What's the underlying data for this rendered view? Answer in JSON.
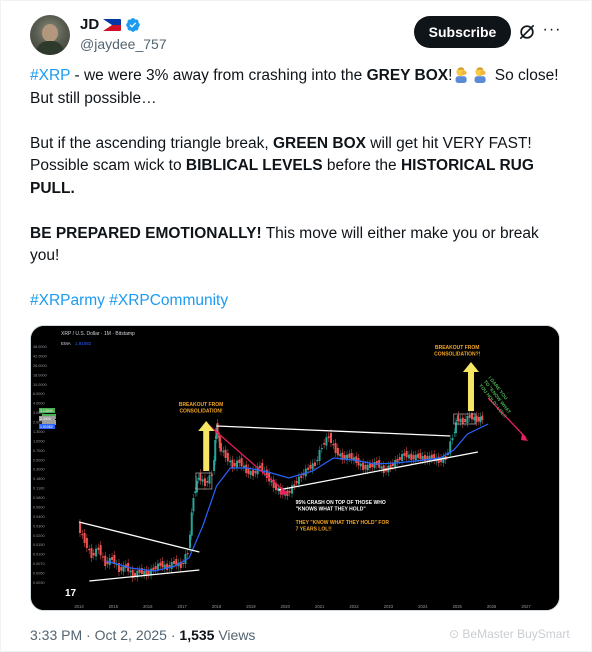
{
  "author": {
    "name": "JD",
    "handle": "@jaydee_757"
  },
  "actions": {
    "subscribe_label": "Subscribe"
  },
  "tweet": {
    "p1": {
      "hashtag": "#XRP",
      "t1": " - we were 3% away from crashing into the ",
      "b1": "GREY BOX",
      "t2": "!",
      "t3": " So close! But still possible…"
    },
    "p2": {
      "t1": "But if the ascending triangle break, ",
      "b1": "GREEN BOX",
      "t2": " will get hit VERY FAST! Possible scam wick to ",
      "b2": "BIBLICAL LEVELS",
      "t3": " before the ",
      "b3": "HISTORICAL RUG PULL."
    },
    "p3": {
      "b1": "BE PREPARED EMOTIONALLY!",
      "t1": " This move will either make you or break you!"
    },
    "p4": {
      "h1": "#XRParmy",
      "h2": "#XRPCommunity"
    }
  },
  "chart": {
    "header": "XRP / U.S. Dollar · 1M · Bitstamp",
    "ema_label": "EMA",
    "ema_value": "1.91082",
    "price_labels": [
      "48.0000",
      "42.0000",
      "26.0000",
      "18.0000",
      "10.0000",
      "6.0000",
      "4.0000",
      "3.0000",
      "2.0000",
      "1.3000",
      "1.0000",
      "0.7000",
      "0.5000",
      "0.3000",
      "0.1800",
      "0.1100",
      "0.0800",
      "0.0600",
      "0.0400",
      "0.0300",
      "0.0200",
      "0.0150",
      "0.0100",
      "0.0070",
      "0.0050",
      "0.0030"
    ],
    "tags": [
      "3.13000",
      "2.3000",
      "1.91082"
    ],
    "years": [
      "2014",
      "2015",
      "2016",
      "2017",
      "2018",
      "2019",
      "2020",
      "2021",
      "2022",
      "2023",
      "2024",
      "2025",
      "2026",
      "2027"
    ],
    "ann_breakout_left": [
      "BREAKOUT FROM",
      "CONSOLIDATION!"
    ],
    "ann_breakout_right": [
      "BREAKOUT FROM",
      "CONSOLIDATION?!"
    ],
    "ann_crash": [
      "95% CRASH ON TOP OF THOSE WHO",
      "\"KNOWS WHAT THEY HOLD\""
    ],
    "ann_years": [
      "THEY \"KNOW WHAT THEY HOLD\" FOR",
      "7 YEARS LOL!!"
    ],
    "ann_dare": [
      "I DARE YOU",
      "TO \"KNOW WHAT",
      "YOU HOLD\" LOL!!"
    ],
    "colors": {
      "up": "#26a69a",
      "down": "#ef5350",
      "ema": "#2962ff",
      "arrow": "#f5e663",
      "annotation": "#f5a623",
      "trend": "#ffffff",
      "pink": "#e91e63",
      "grey_box": "#9e9e9e",
      "green_box": "#4caf50"
    }
  },
  "meta": {
    "time": "3:33 PM · Oct 2, 2025 · ",
    "views": "1,535",
    "views_label": " Views"
  },
  "watermark": "BeMaster BuySmart"
}
